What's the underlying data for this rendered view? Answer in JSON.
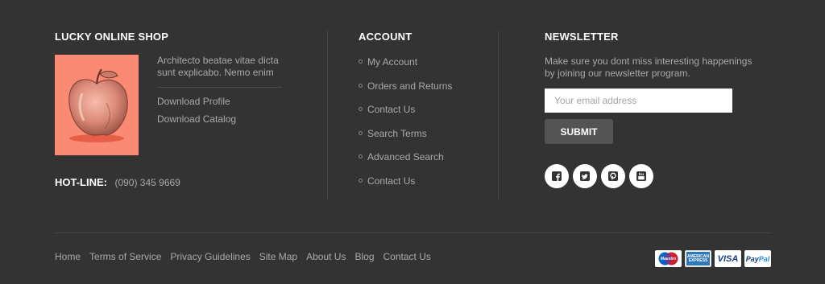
{
  "shop": {
    "title": "LUCKY ONLINE SHOP",
    "description": "Architecto beatae vitae dicta sunt explicabo. Nemo enim",
    "links": [
      "Download Profile",
      "Download Catalog"
    ],
    "hotline_label": "HOT-LINE:",
    "hotline_number": "(090) 345 9669"
  },
  "account": {
    "title": "ACCOUNT",
    "links": [
      "My Account",
      "Orders and Returns",
      "Contact Us",
      "Search Terms",
      "Advanced Search",
      "Contact Us"
    ]
  },
  "newsletter": {
    "title": "NEWSLETTER",
    "description": "Make sure you dont miss interesting happenings by joining our newsletter program.",
    "email_placeholder": "Your email address",
    "submit_label": "SUBMIT",
    "social": [
      "facebook-icon",
      "twitter-icon",
      "pinterest-icon",
      "youtube-icon"
    ]
  },
  "bottom_nav": [
    "Home",
    "Terms of Service",
    "Privacy Guidelines",
    "Site Map",
    "About Us",
    "Blog",
    "Contact Us"
  ],
  "payments": {
    "maestro": "Maestro",
    "amex_top": "AMERICAN",
    "amex_bottom": "EXPRESS",
    "visa": "VISA",
    "paypal_1": "Pay",
    "paypal_2": "Pal"
  },
  "colors": {
    "background": "#333333",
    "text": "#a9a9a9",
    "heading": "#ffffff",
    "image_bg": "#fa8a74",
    "button": "#545454"
  }
}
